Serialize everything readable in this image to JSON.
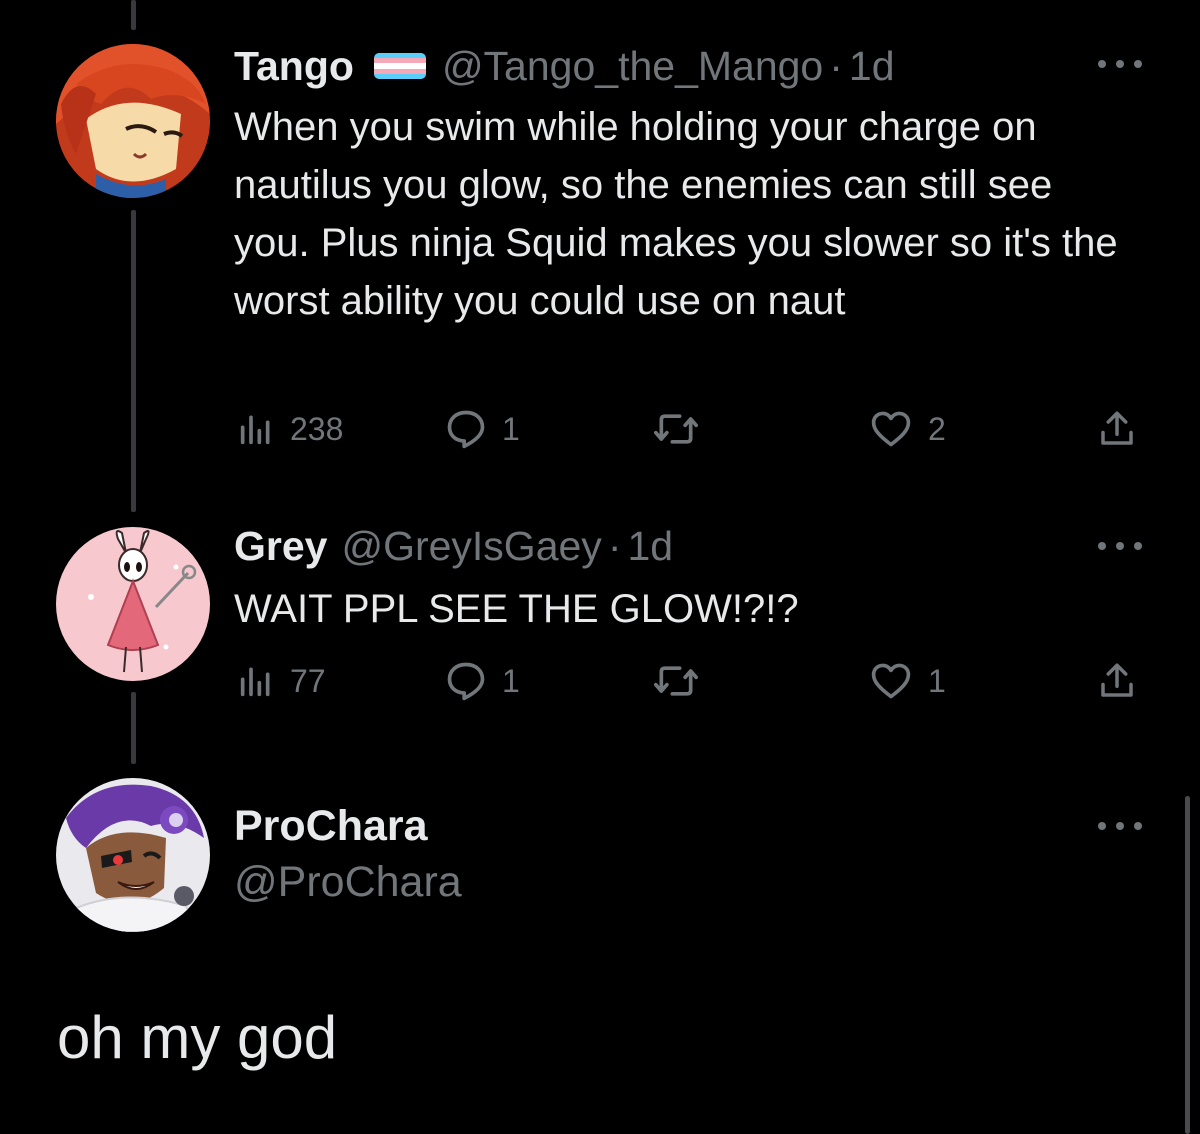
{
  "tweets": [
    {
      "display_name": "Tango",
      "handle": "@Tango_the_Mango",
      "separator": "·",
      "time": "1d",
      "text": "When you swim while holding your charge on nautilus you glow, so the enemies can still see you. Plus ninja Squid makes you slower so it's the worst ability you could use on naut",
      "views": "238",
      "replies": "1",
      "likes": "2"
    },
    {
      "display_name": "Grey",
      "handle": "@GreyIsGaey",
      "separator": "·",
      "time": "1d",
      "text": "WAIT PPL SEE THE GLOW!?!?",
      "views": "77",
      "replies": "1",
      "likes": "1"
    }
  ],
  "main_tweet": {
    "display_name": "ProChara",
    "handle": "@ProChara",
    "text": "oh my god"
  },
  "colors": {
    "background": "#000000",
    "primary_text": "#e7e9ea",
    "secondary_text": "#71767b",
    "thread_line": "#38393d",
    "flag_blue": "#5bcefa",
    "flag_pink": "#f5a9b8",
    "flag_white": "#ffffff"
  },
  "icons": {
    "views": "views-icon",
    "reply": "reply-icon",
    "retweet": "retweet-icon",
    "like": "like-icon",
    "share": "share-icon",
    "more": "more-icon",
    "flag": "trans-flag-emoji"
  }
}
